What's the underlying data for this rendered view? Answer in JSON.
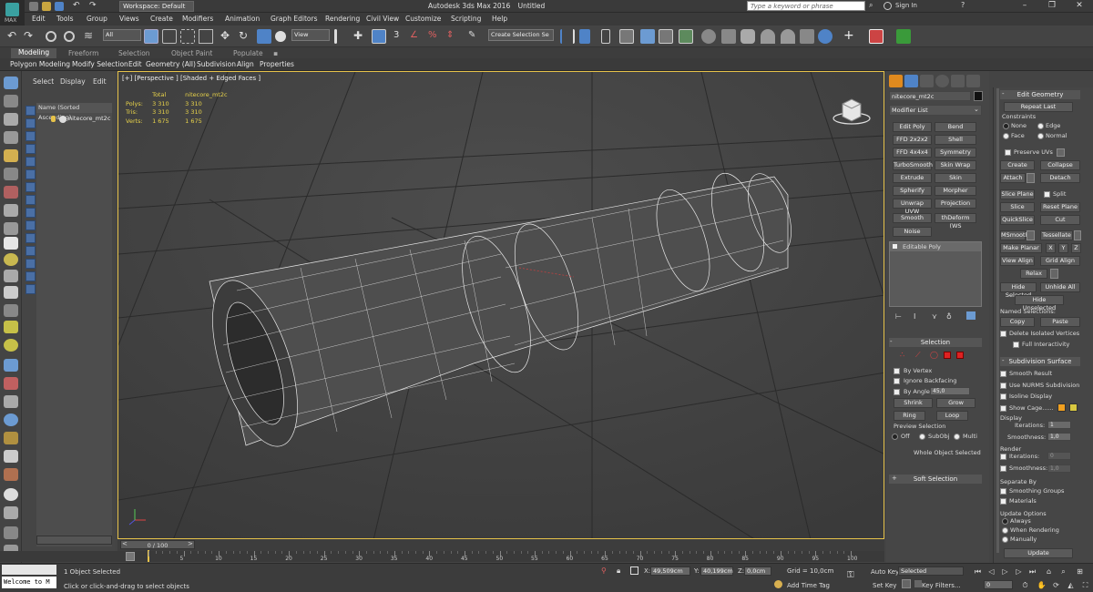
{
  "app": {
    "title": "Autodesk 3ds Max 2016",
    "document": "Untitled",
    "workspace": "Workspace: Default",
    "search_placeholder": "Type a keyword or phrase",
    "sign_in": "Sign In",
    "logo_text": "MAX"
  },
  "menu": [
    "Edit",
    "Tools",
    "Group",
    "Views",
    "Create",
    "Modifiers",
    "Animation",
    "Graph Editors",
    "Rendering",
    "Civil View",
    "Customize",
    "Scripting",
    "Help"
  ],
  "toolbar": {
    "filter_select": "All",
    "refcoord_select": "View",
    "selection_set": "Create Selection Se"
  },
  "ribbon": {
    "tabs": [
      "Modeling",
      "Freeform",
      "Selection",
      "Object Paint",
      "Populate"
    ],
    "active_tab": "Modeling",
    "subtabs": [
      "Polygon Modeling",
      "Modify Selection",
      "Edit",
      "Geometry (All)",
      "Subdivision",
      "Align",
      "Properties"
    ]
  },
  "scene_explorer": {
    "tabs": [
      "Select",
      "Display",
      "Edit"
    ],
    "column_header": "Name (Sorted Ascending)",
    "items": [
      "nitecore_mt2c"
    ]
  },
  "viewport": {
    "label": "[+] [Perspective ] [Shaded + Edged Faces ]",
    "stats": {
      "col_total": "Total",
      "col_object": "nitecore_mt2c",
      "rows": [
        {
          "label": "Polys:",
          "total": "3 310",
          "object": "3 310"
        },
        {
          "label": "Tris:",
          "total": "3 310",
          "object": "3 310"
        },
        {
          "label": "Verts:",
          "total": "1 675",
          "object": "1 675"
        }
      ]
    }
  },
  "command_panel": {
    "object_name": "nitecore_mt2c",
    "modifier_list": "Modifier List",
    "modifier_buttons": [
      [
        "Edit Poly",
        "Bend"
      ],
      [
        "FFD 2x2x2",
        "Shell"
      ],
      [
        "FFD 4x4x4",
        "Symmetry"
      ],
      [
        "TurboSmooth",
        "Skin Wrap"
      ],
      [
        "Extrude",
        "Skin"
      ],
      [
        "Spherify",
        "Morpher"
      ],
      [
        "Unwrap UVW",
        "Projection"
      ],
      [
        "Smooth",
        "thDeform (WS"
      ],
      [
        "Noise",
        ""
      ]
    ],
    "stack": [
      "Editable Poly"
    ],
    "selection": {
      "title": "Selection",
      "by_vertex": "By Vertex",
      "ignore_backfacing": "Ignore Backfacing",
      "by_angle": "By Angle:",
      "by_angle_value": "45,0",
      "shrink": "Shrink",
      "grow": "Grow",
      "ring": "Ring",
      "loop": "Loop",
      "preview_selection": "Preview Selection",
      "preview_options": [
        "Off",
        "SubObj",
        "Multi"
      ],
      "status": "Whole Object Selected"
    },
    "soft_selection": "Soft Selection"
  },
  "edit_geometry": {
    "title": "Edit Geometry",
    "repeat_last": "Repeat Last",
    "constraints_label": "Constraints",
    "constraints": [
      "None",
      "Edge",
      "Face",
      "Normal"
    ],
    "preserve_uvs": "Preserve UVs",
    "create": "Create",
    "collapse": "Collapse",
    "attach": "Attach",
    "detach": "Detach",
    "slice_plane": "Slice Plane",
    "split": "Split",
    "slice": "Slice",
    "reset_plane": "Reset Plane",
    "quickslice": "QuickSlice",
    "cut": "Cut",
    "msmooth": "MSmooth",
    "tessellate": "Tessellate",
    "make_planar": "Make Planar",
    "xyz": [
      "X",
      "Y",
      "Z"
    ],
    "view_align": "View Align",
    "grid_align": "Grid Align",
    "relax": "Relax",
    "hide_selected": "Hide Selected",
    "unhide_all": "Unhide All",
    "hide_unselected": "Hide Unselected",
    "named_selections": "Named Selections:",
    "copy": "Copy",
    "paste": "Paste",
    "delete_isolated": "Delete Isolated Vertices",
    "full_interactivity": "Full Interactivity"
  },
  "subdivision": {
    "title": "Subdivision Surface",
    "smooth_result": "Smooth Result",
    "use_nurms": "Use NURMS Subdivision",
    "isoline_display": "Isoline Display",
    "show_cage": "Show Cage......",
    "display_label": "Display",
    "iterations": "Iterations:",
    "iterations_val": "1",
    "smoothness": "Smoothness:",
    "smoothness_val": "1,0",
    "render_label": "Render",
    "render_iterations_val": "0",
    "render_smoothness_val": "1,0",
    "separate_by": "Separate By",
    "smoothing_groups": "Smoothing Groups",
    "materials": "Materials",
    "update_options": "Update Options",
    "update_modes": [
      "Always",
      "When Rendering",
      "Manually"
    ],
    "update": "Update",
    "cage_colors": [
      "#f0a020",
      "#d8c840"
    ]
  },
  "timeline": {
    "slider": "0 / 100",
    "ticks": [
      "0",
      "5",
      "10",
      "15",
      "20",
      "25",
      "30",
      "35",
      "40",
      "45",
      "50",
      "55",
      "60",
      "65",
      "70",
      "75",
      "80",
      "85",
      "90",
      "95",
      "100"
    ]
  },
  "status": {
    "maxscript_top": "",
    "maxscript_bottom": "Welcome to M",
    "selected": "1 Object Selected",
    "prompt": "Click or click-and-drag to select objects",
    "x_label": "X:",
    "x_value": "49,509cm",
    "y_label": "Y:",
    "y_value": "40,199cm",
    "z_label": "Z:",
    "z_value": "0,0cm",
    "grid": "Grid = 10,0cm",
    "add_time_tag": "Add Time Tag",
    "auto_key": "Auto Key",
    "set_key": "Set Key",
    "selected_dropdown": "Selected",
    "key_filters": "Key Filters...",
    "frame": "0"
  }
}
